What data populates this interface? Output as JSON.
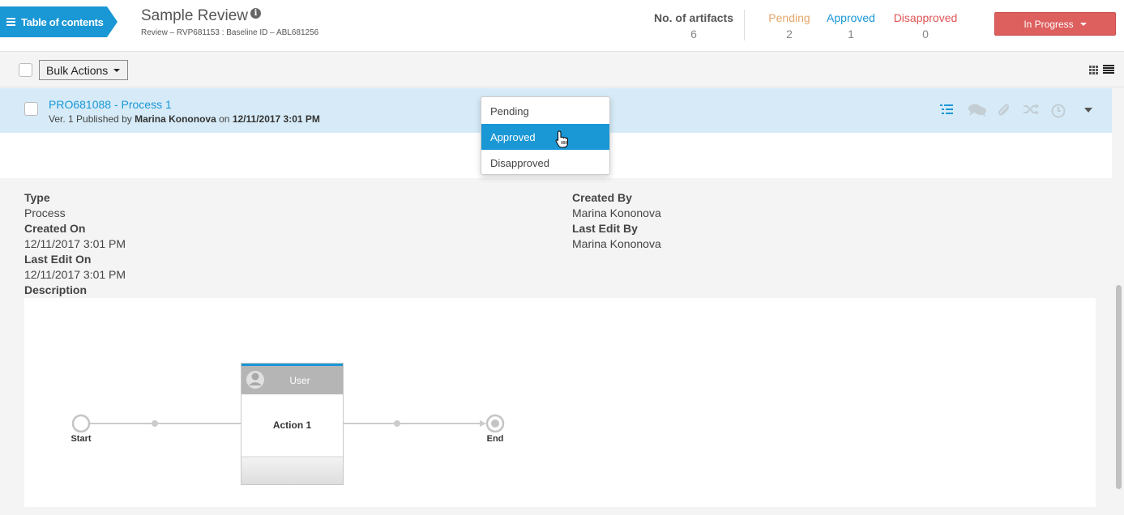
{
  "header": {
    "toc_label": "Table of contents",
    "title": "Sample Review",
    "subtitle": "Review – RVP681153 : Baseline ID – ABL681256",
    "stats": {
      "artifacts_label": "No. of artifacts",
      "artifacts_value": "6",
      "pending_label": "Pending",
      "pending_value": "2",
      "approved_label": "Approved",
      "approved_value": "1",
      "disapproved_label": "Disapproved",
      "disapproved_value": "0"
    },
    "status_button": "In Progress"
  },
  "toolbar": {
    "bulk_actions": "Bulk Actions"
  },
  "artifact": {
    "id_title": "PRO681088 - Process 1",
    "meta_prefix": "Ver. 1 Published by",
    "author": "Marina Kononova",
    "meta_on": "on",
    "published_at": "12/11/2017 3:01 PM"
  },
  "details": {
    "type_label": "Type",
    "type_value": "Process",
    "created_on_label": "Created On",
    "created_on_value": "12/11/2017 3:01 PM",
    "last_edit_on_label": "Last Edit On",
    "last_edit_on_value": "12/11/2017 3:01 PM",
    "description_label": "Description",
    "created_by_label": "Created By",
    "created_by_value": "Marina Kononova",
    "last_edit_by_label": "Last Edit By",
    "last_edit_by_value": "Marina Kononova"
  },
  "diagram": {
    "start_label": "Start",
    "end_label": "End",
    "lane_label": "User",
    "action_label": "Action 1"
  },
  "status_dropdown": {
    "options": [
      "Pending",
      "Approved",
      "Disapproved"
    ],
    "selected": "Approved"
  },
  "colors": {
    "accent": "#1a97d5",
    "pending": "#e5a66a",
    "disapproved": "#e05555",
    "in_progress": "#dd5f5e",
    "row_highlight": "#d6ebf7"
  }
}
